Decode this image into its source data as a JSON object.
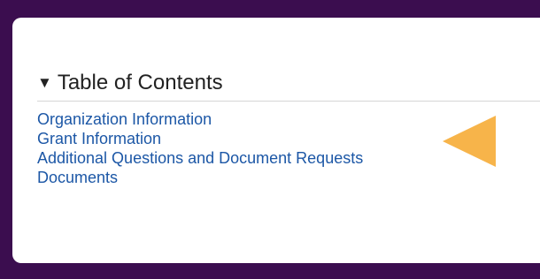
{
  "toc": {
    "toggle_glyph": "▼",
    "title": "Table of Contents",
    "items": [
      {
        "label": "Organization Information"
      },
      {
        "label": "Grant Information"
      },
      {
        "label": "Additional Questions and Document Requests"
      },
      {
        "label": "Documents"
      }
    ]
  },
  "colors": {
    "frame": "#3b0d4f",
    "link": "#1c57a6",
    "annotation_arrow": "#f7b44a"
  },
  "icons": {
    "toggle": "caret-down-icon",
    "annotation": "left-pointing-arrow-icon"
  }
}
